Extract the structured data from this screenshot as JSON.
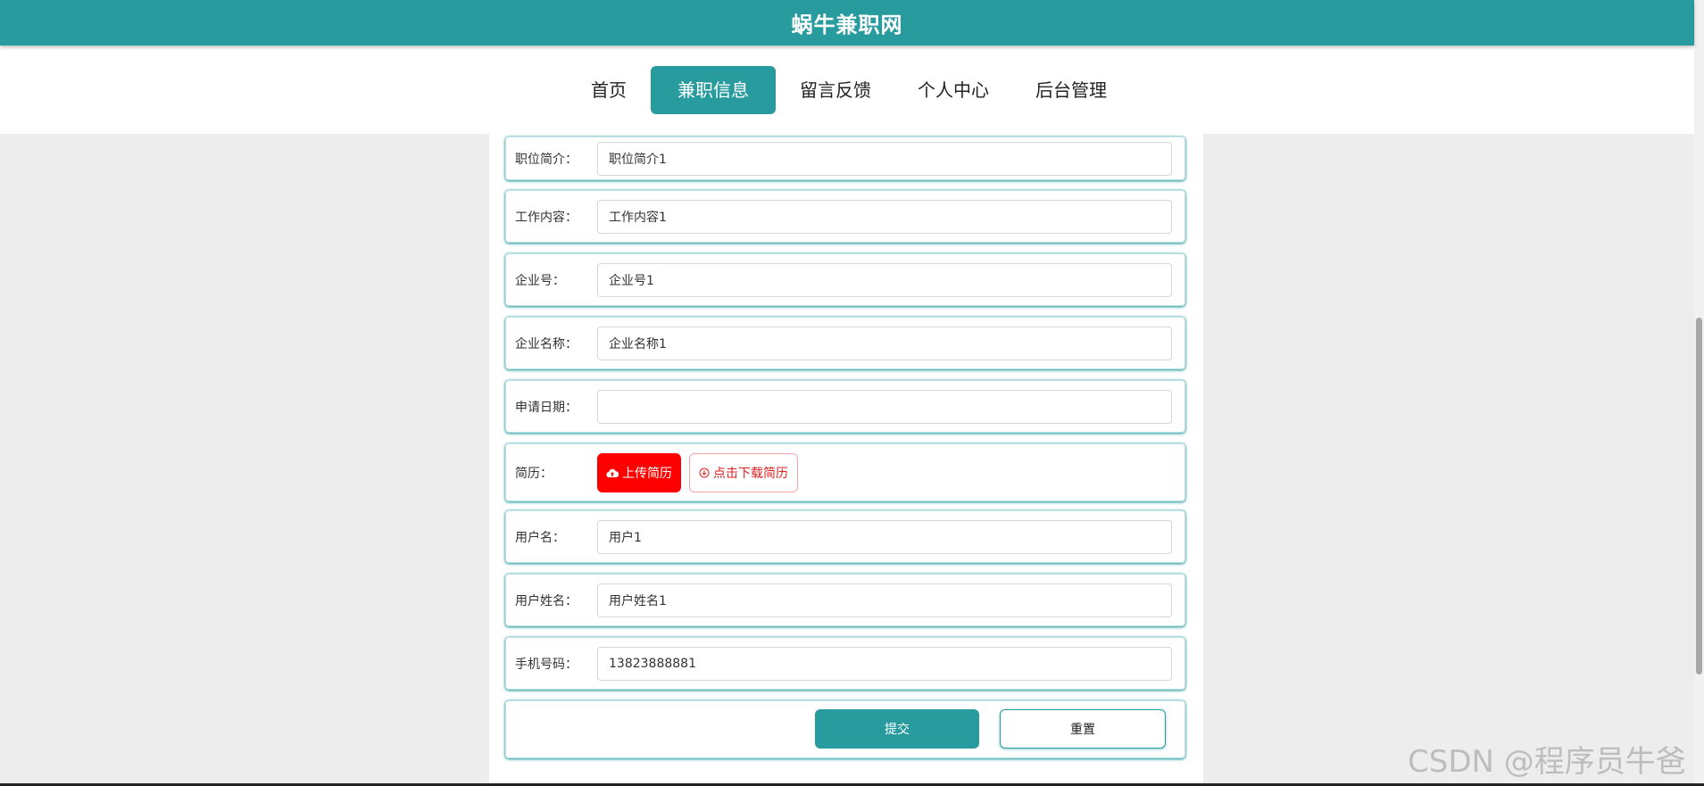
{
  "site": {
    "title": "蜗牛兼职网"
  },
  "nav": {
    "items": [
      {
        "label": "首页"
      },
      {
        "label": "兼职信息"
      },
      {
        "label": "留言反馈"
      },
      {
        "label": "个人中心"
      },
      {
        "label": "后台管理"
      }
    ],
    "active": "兼职信息"
  },
  "form": {
    "fields": [
      {
        "label": "职位简介：",
        "value": "职位简介1"
      },
      {
        "label": "工作内容：",
        "value": "工作内容1"
      },
      {
        "label": "企业号：",
        "value": "企业号1"
      },
      {
        "label": "企业名称：",
        "value": "企业名称1"
      },
      {
        "label": "申请日期：",
        "value": ""
      }
    ],
    "resume": {
      "label": "简历：",
      "upload_label": "上传简历",
      "download_label": "点击下载简历"
    },
    "fields2": [
      {
        "label": "用户名：",
        "value": "用户1"
      },
      {
        "label": "用户姓名：",
        "value": "用户姓名1"
      },
      {
        "label": "手机号码：",
        "value": "13823888881"
      }
    ],
    "submit_label": "提交",
    "reset_label": "重置"
  },
  "watermark": "CSDN @程序员牛爸",
  "colors": {
    "primary": "#279b9e",
    "upload": "#ff0000"
  }
}
